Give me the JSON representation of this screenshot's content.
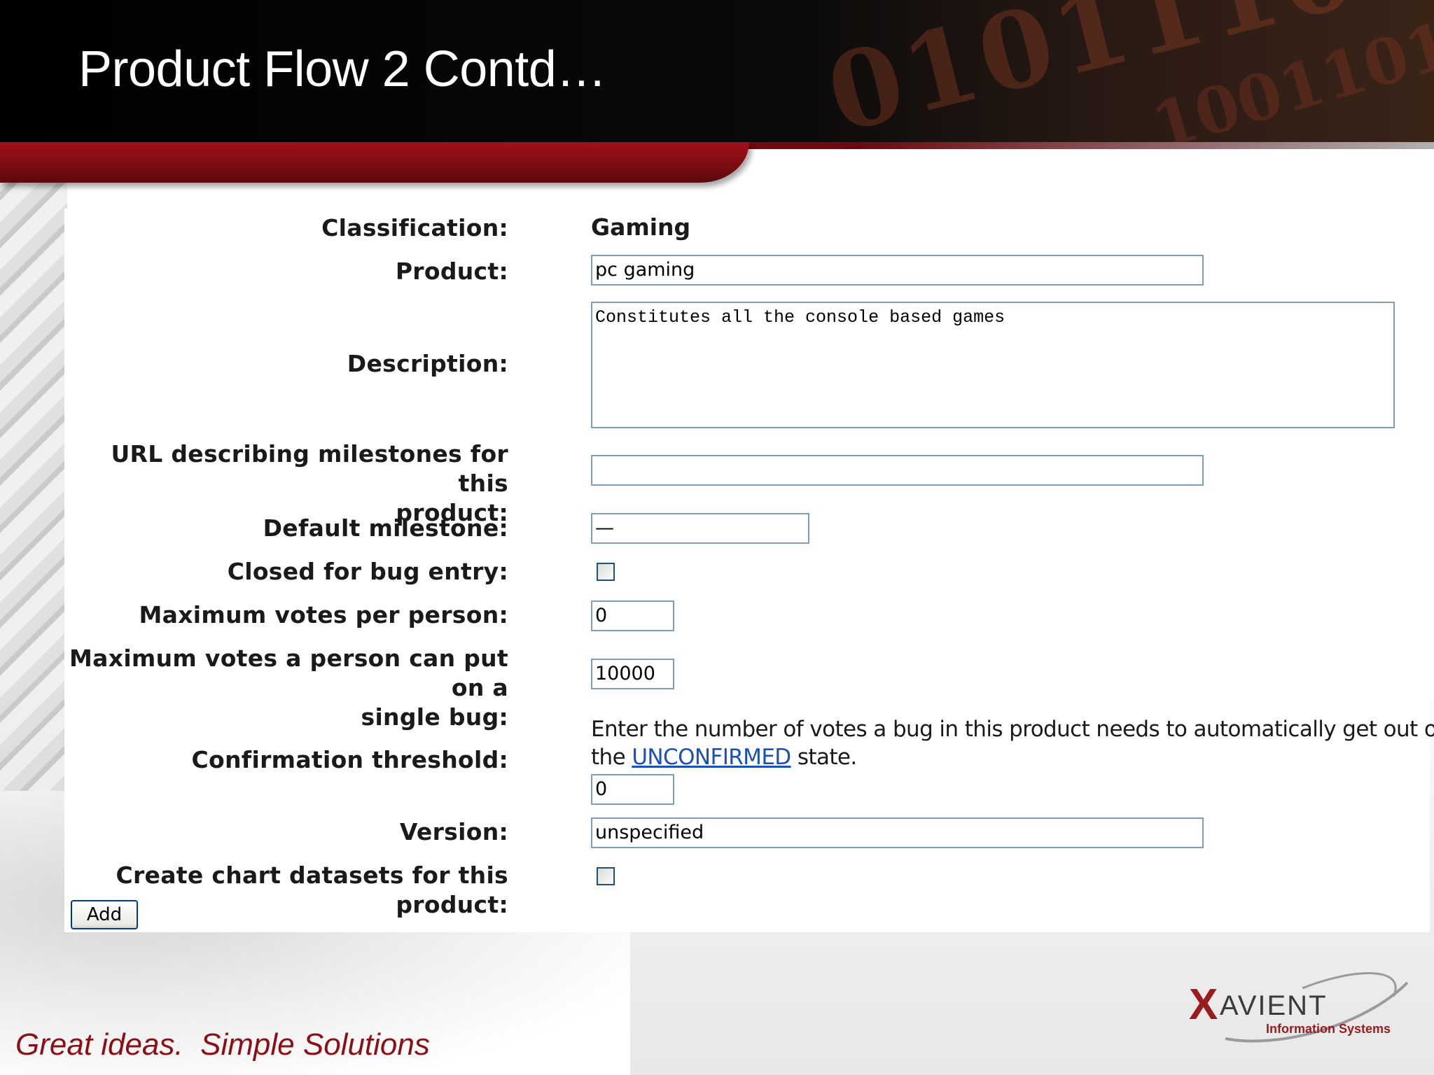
{
  "slide": {
    "title": "Product Flow 2 Contd…",
    "tagline": "Great ideas.  Simple Solutions",
    "logo": {
      "wordmark": "XAVIENT",
      "subtitle": "Information Systems"
    }
  },
  "form": {
    "classification": {
      "label": "Classification:",
      "value": "Gaming"
    },
    "product": {
      "label": "Product:",
      "value": "pc gaming"
    },
    "description": {
      "label": "Description:",
      "value": "Constitutes all the console based games"
    },
    "milestone_url": {
      "label_line1": "URL describing milestones for this",
      "label_line2": "product:",
      "value": ""
    },
    "default_milestone": {
      "label": "Default milestone:",
      "value": "—"
    },
    "closed_for_bug_entry": {
      "label": "Closed for bug entry:",
      "checked": false
    },
    "max_votes_per_person": {
      "label": "Maximum votes per person:",
      "value": "0"
    },
    "max_votes_single_bug": {
      "label_line1": "Maximum votes a person can put on a",
      "label_line2": "single bug:",
      "value": "10000"
    },
    "confirmation_threshold": {
      "label": "Confirmation threshold:",
      "help_before": "Enter the number of votes a bug in this product needs to automatically get out of the ",
      "help_link": "UNCONFIRMED",
      "help_after": " state.",
      "value": "0"
    },
    "version": {
      "label": "Version:",
      "value": "unspecified"
    },
    "create_chart_datasets": {
      "label": "Create chart datasets for this product:",
      "checked": false
    },
    "add_button_label": "Add"
  },
  "colors": {
    "header_red": "#8b1016",
    "tagline": "#8b1016",
    "link": "#1a50b8",
    "input_border": "#7f9db9"
  }
}
